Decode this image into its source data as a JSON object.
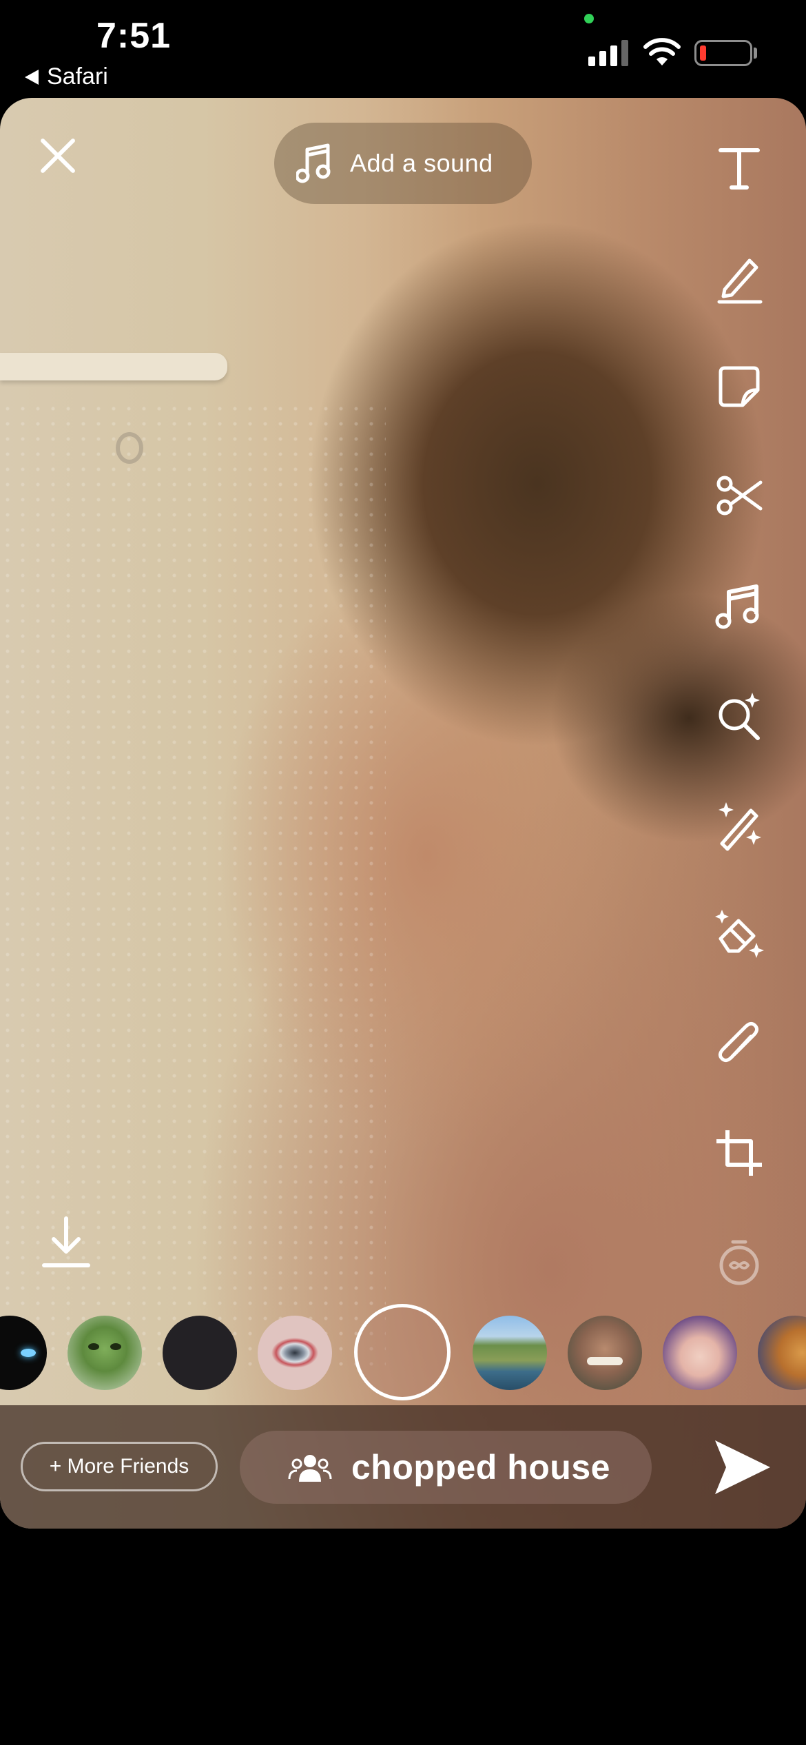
{
  "status_bar": {
    "time": "7:51",
    "back_app": "Safari",
    "camera_indicator_color": "#31d158",
    "battery_color": "#ff3b30"
  },
  "top_controls": {
    "close_icon": "close-icon",
    "add_sound_label": "Add a sound"
  },
  "tools": [
    {
      "name": "text-tool",
      "icon": "text-icon"
    },
    {
      "name": "draw-tool",
      "icon": "pencil-icon"
    },
    {
      "name": "sticker-tool",
      "icon": "sticker-icon"
    },
    {
      "name": "scissors-tool",
      "icon": "scissors-icon"
    },
    {
      "name": "music-tool",
      "icon": "music-note-icon"
    },
    {
      "name": "lens-explore-tool",
      "icon": "search-sparkle-icon"
    },
    {
      "name": "magic-wand-tool",
      "icon": "magic-wand-icon"
    },
    {
      "name": "eraser-tool",
      "icon": "eraser-sparkle-icon"
    },
    {
      "name": "attach-link-tool",
      "icon": "paperclip-icon"
    },
    {
      "name": "crop-tool",
      "icon": "crop-icon"
    },
    {
      "name": "timer-tool",
      "icon": "timer-infinity-icon"
    }
  ],
  "lenses": [
    {
      "name": "lens-blue-eye"
    },
    {
      "name": "lens-green-alien"
    },
    {
      "name": "lens-dark"
    },
    {
      "name": "lens-red-eye"
    },
    {
      "name": "lens-none-selected"
    },
    {
      "name": "lens-landscape"
    },
    {
      "name": "lens-caricature"
    },
    {
      "name": "lens-sparkle-face"
    },
    {
      "name": "lens-food"
    }
  ],
  "bottom_bar": {
    "more_friends_label": "+ More Friends",
    "group_name": "chopped house"
  }
}
